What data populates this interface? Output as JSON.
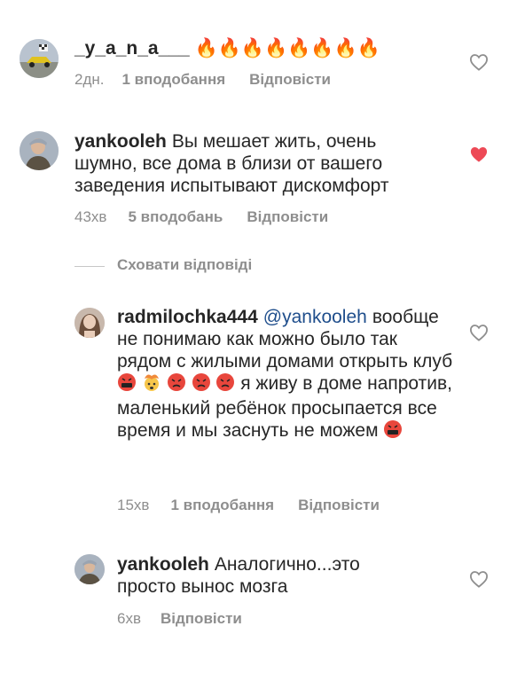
{
  "comments": [
    {
      "username": "_y_a_n_a___",
      "text": "🔥🔥🔥🔥🔥🔥🔥🔥",
      "time": "2дн.",
      "likes": "1 вподобання",
      "reply": "Відповісти",
      "liked": false
    },
    {
      "username": "yankooleh",
      "text": "Вы мешает жить, очень шумно, все дома в близи от вашего заведения испытывают дискомфорт",
      "time": "43хв",
      "likes": "5 вподобань",
      "reply": "Відповісти",
      "liked": true
    }
  ],
  "hide_replies": "Сховати відповіді",
  "replies": [
    {
      "username": "radmilochka444",
      "mention": "@yankooleh",
      "text_1": "вообще не понимаю как можно было так рядом с жилыми домами открыть клуб",
      "text_2": "я живу в доме напротив, маленький ребёнок просыпается все время и мы заснуть не можем",
      "time": "15хв",
      "likes": "1 вподобання",
      "reply": "Відповісти",
      "liked": false
    },
    {
      "username": "yankooleh",
      "text": "Аналогично...это просто вынос мозга",
      "time": "6хв",
      "reply": "Відповісти",
      "liked": false
    }
  ],
  "colors": {
    "text": "#262626",
    "meta": "#8e8e8e",
    "mention": "#1f4e8c",
    "heart_active": "#ed4956"
  }
}
